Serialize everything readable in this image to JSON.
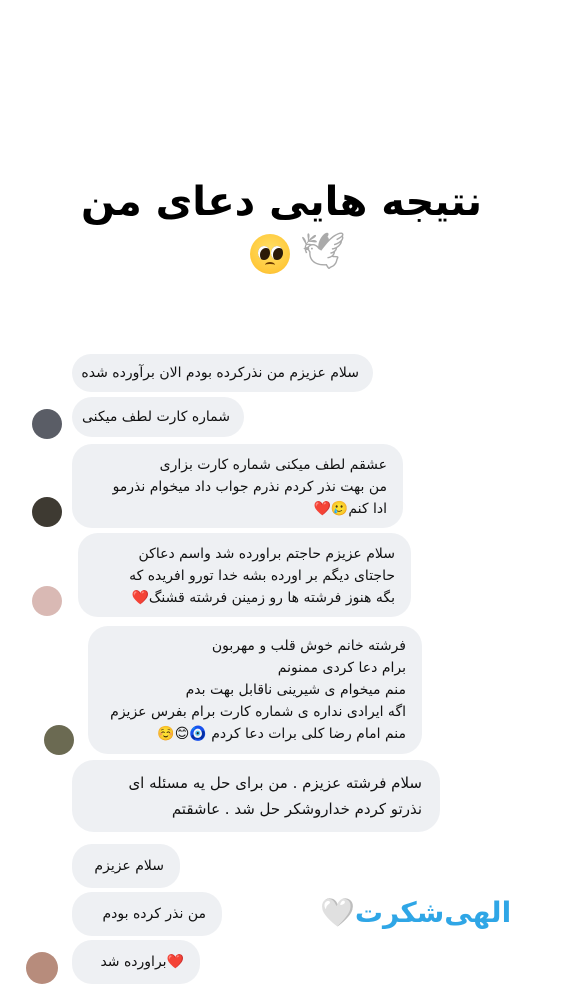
{
  "header": {
    "title": "نتیجه هایی دعای من",
    "emojis": [
      "dove-icon",
      "pleading-face-icon"
    ]
  },
  "messages": [
    {
      "lines": [
        "سلام عزیزم من نذرکرده بودم الان برآورده شده"
      ]
    },
    {
      "lines": [
        "شماره کارت لطف میکنی"
      ]
    },
    {
      "lines": [
        "عشقم لطف میکنی شماره کارت بزاری",
        "من بهت نذر کردم نذرم جواب داد میخوام نذرمو",
        "ادا کنم🥲❤️"
      ]
    },
    {
      "lines": [
        "سلام عزیزم حاجتم براورده شد واسم دعاکن",
        "حاجتای دیگم بر اورده بشه خدا تورو افریده که",
        "بگه هنوز فرشته ها رو زمینن فرشته قشنگ❤️"
      ]
    },
    {
      "lines": [
        "فرشته خانم خوش قلب و مهربون",
        "برام دعا کردی ممنونم",
        "منم میخوام ی شیرینی ناقابل بهت بدم",
        "اگه ایرادی نداره ی شماره کارت برام بفرس عزیزم",
        "منم امام رضا کلی برات دعا کردم 🧿😊☺️"
      ]
    },
    {
      "lines": [
        "سلام فرشته عزیزم . من برای حل یه مسئله ای",
        "نذرتو کردم خداروشکر حل شد . عاشقتم"
      ]
    },
    {
      "lines": [
        "سلام عزیزم"
      ]
    },
    {
      "lines": [
        "من نذر کرده بودم"
      ]
    },
    {
      "lines": [
        "❤️براورده شد"
      ]
    }
  ],
  "signature": {
    "text": "الهی‌شکرت🤍",
    "color": "#2fa6e6"
  }
}
